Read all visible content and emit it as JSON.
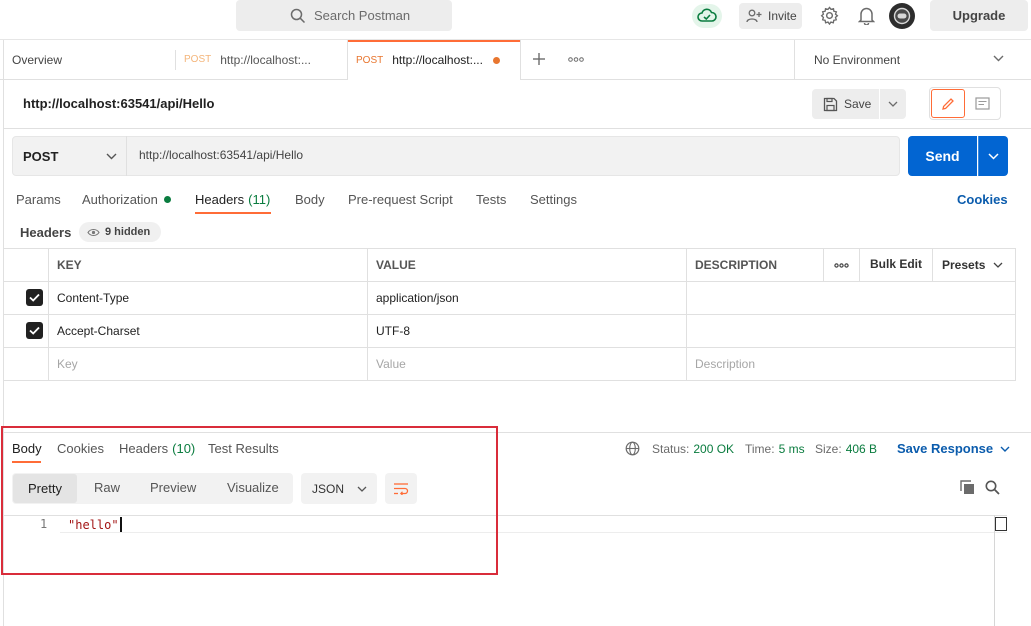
{
  "topbar": {
    "search_placeholder": "Search Postman",
    "invite_label": "Invite",
    "upgrade_label": "Upgrade"
  },
  "tabs": {
    "overview_label": "Overview",
    "tab1": {
      "method": "POST",
      "url": "http://localhost:..."
    },
    "tab2": {
      "method": "POST",
      "url": "http://localhost:..."
    },
    "environment": "No Environment"
  },
  "request": {
    "title": "http://localhost:63541/api/Hello",
    "save_label": "Save",
    "method": "POST",
    "url": "http://localhost:63541/api/Hello",
    "send_label": "Send",
    "cookies_label": "Cookies"
  },
  "request_tabs": {
    "params": "Params",
    "authorization": "Authorization",
    "headers": "Headers",
    "headers_count": "(11)",
    "body": "Body",
    "prerequest": "Pre-request Script",
    "tests": "Tests",
    "settings": "Settings"
  },
  "headers_section": {
    "label": "Headers",
    "hidden_label": "9 hidden"
  },
  "headers_table": {
    "columns": {
      "key": "KEY",
      "value": "VALUE",
      "description": "DESCRIPTION"
    },
    "bulk_edit": "Bulk Edit",
    "presets": "Presets",
    "rows": [
      {
        "key": "Content-Type",
        "value": "application/json",
        "checked": true
      },
      {
        "key": "Accept-Charset",
        "value": "UTF-8",
        "checked": true
      }
    ],
    "placeholder": {
      "key": "Key",
      "value": "Value",
      "description": "Description"
    }
  },
  "response": {
    "tabs": {
      "body": "Body",
      "cookies": "Cookies",
      "headers": "Headers",
      "headers_count": "(10)",
      "test_results": "Test Results"
    },
    "status_label": "Status:",
    "status_value": "200 OK",
    "time_label": "Time:",
    "time_value": "5 ms",
    "size_label": "Size:",
    "size_value": "406 B",
    "save_response": "Save Response",
    "views": {
      "pretty": "Pretty",
      "raw": "Raw",
      "preview": "Preview",
      "visualize": "Visualize"
    },
    "format": "JSON",
    "code": {
      "line_number": "1",
      "text": "\"hello\""
    }
  },
  "colors": {
    "accent_orange": "#ff6c37",
    "send_blue": "#0265d2",
    "link_blue": "#0b5cad",
    "success_green": "#0a7c3f",
    "highlight_red": "#d92c3a"
  }
}
